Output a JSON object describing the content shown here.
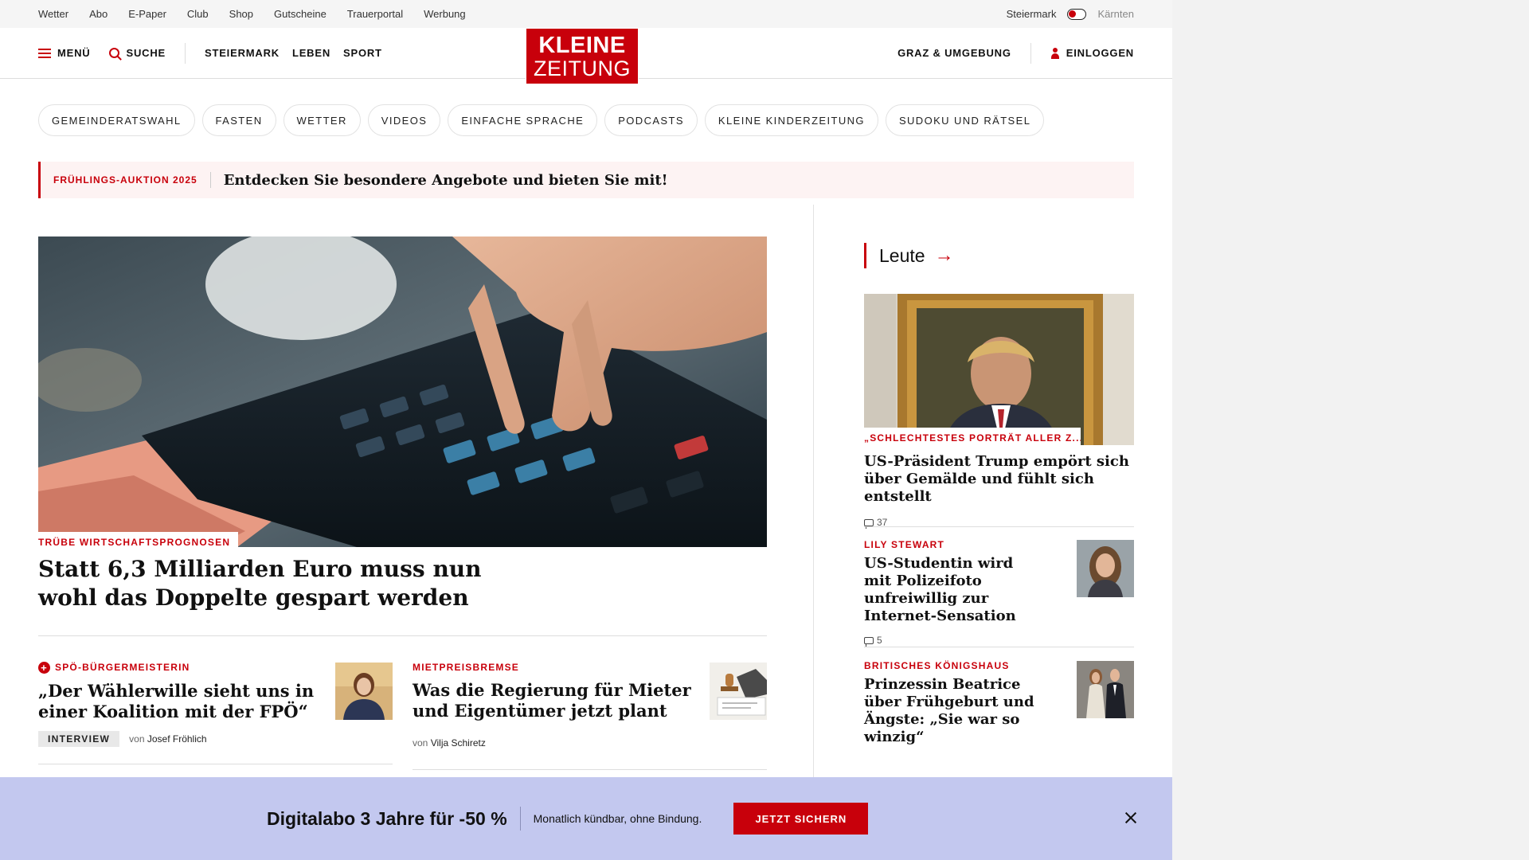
{
  "topbar": {
    "links": [
      "Wetter",
      "Abo",
      "E-Paper",
      "Club",
      "Shop",
      "Gutscheine",
      "Trauerportal",
      "Werbung"
    ],
    "region_active": "Steiermark",
    "region_inactive": "Kärnten"
  },
  "header": {
    "menu_label": "MENÜ",
    "search_label": "SUCHE",
    "nav": [
      "STEIERMARK",
      "LEBEN",
      "SPORT"
    ],
    "logo_line1": "KLEINE",
    "logo_line2": "ZEITUNG",
    "region_label": "GRAZ & UMGEBUNG",
    "login_label": "EINLOGGEN"
  },
  "pills": [
    "GEMEINDERATSWAHL",
    "FASTEN",
    "WETTER",
    "VIDEOS",
    "EINFACHE SPRACHE",
    "PODCASTS",
    "KLEINE KINDERZEITUNG",
    "SUDOKU UND RÄTSEL"
  ],
  "promo": {
    "tag": "FRÜHLINGS-AUKTION 2025",
    "text": "Entdecken Sie besondere Angebote und bieten Sie mit!"
  },
  "lead": {
    "kicker": "TRÜBE WIRTSCHAFTSPROGNOSEN",
    "title": "Statt 6,3 Milliarden Euro muss nun wohl das Doppelte gespart werden",
    "image": "calculator-and-euro-notes"
  },
  "teasers": [
    {
      "kicker": "SPÖ-BÜRGERMEISTERIN",
      "premium_icon": "+",
      "title": "„Der Wählerwille sieht uns in einer Koalition mit der FPÖ“",
      "badge": "INTERVIEW",
      "by": "von",
      "author": "Josef Fröhlich"
    },
    {
      "kicker": "MIETPREISBREMSE",
      "title": "Was die Regierung für Mieter und Eigentümer jetzt plant",
      "by": "von",
      "author": "Vilja Schiretz"
    }
  ],
  "sidebar": {
    "heading": "Leute",
    "arrow": "→",
    "items": [
      {
        "kicker": "„SCHLECHTESTES PORTRÄT ALLER Z...",
        "title": "US-Präsident Trump empört sich über Gemälde und fühlt sich entstellt",
        "comments": "37"
      },
      {
        "kicker": "LILY STEWART",
        "title": "US-Studentin wird mit Polizeifoto unfreiwillig zur Internet-Sensation",
        "comments": "5"
      },
      {
        "kicker": "BRITISCHES KÖNIGSHAUS",
        "title": "Prinzessin Beatrice über Frühgeburt und Ängste: „Sie war so winzig“"
      }
    ]
  },
  "banner": {
    "headline": "Digitalabo 3 Jahre für -50 %",
    "sub": "Monatlich kündbar, ohne Bindung.",
    "cta": "JETZT SICHERN"
  },
  "colors": {
    "brand_red": "#c8000b",
    "banner_bg": "#c3c8ef",
    "promo_bg": "#fdf3f3"
  }
}
